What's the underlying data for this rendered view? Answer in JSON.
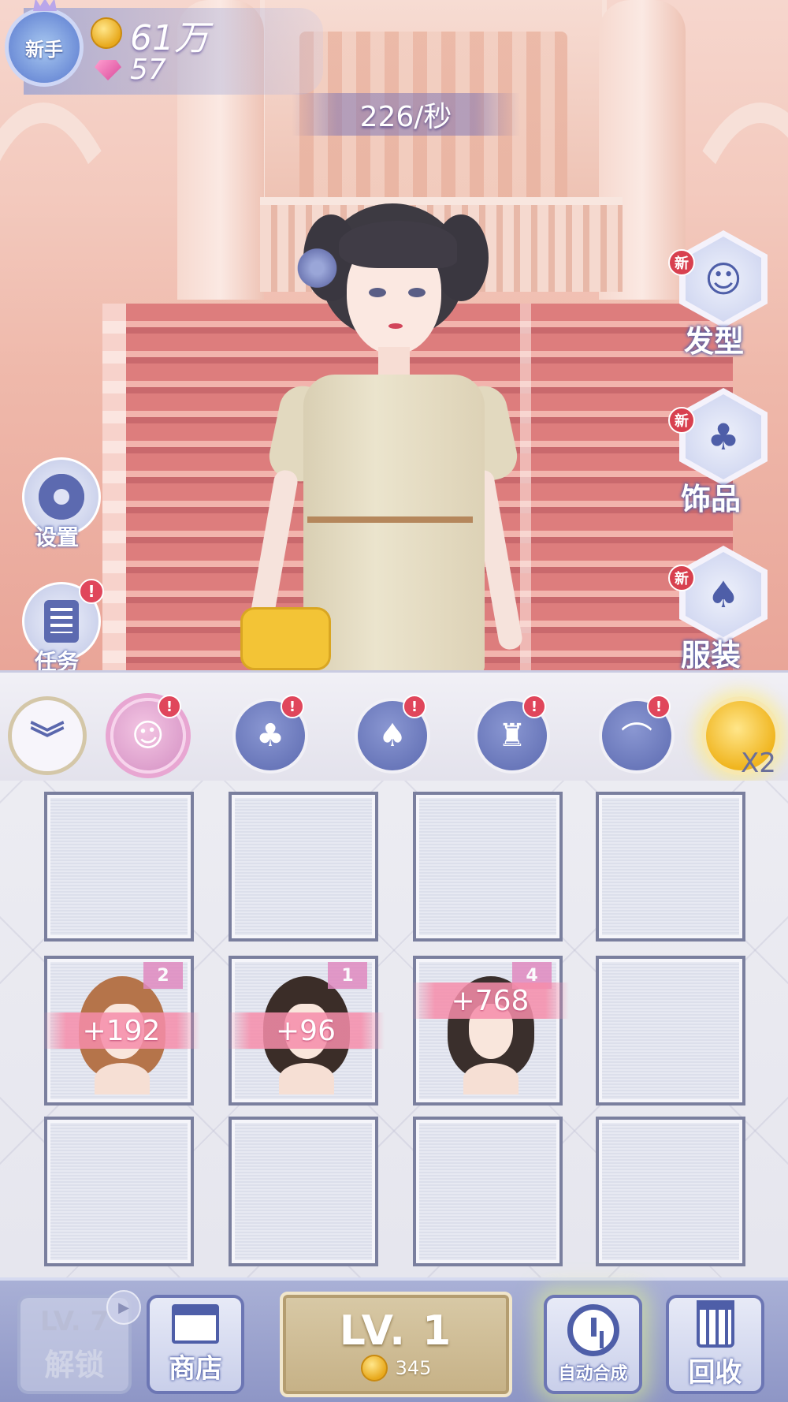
{
  "hud": {
    "avatar_label": "新手",
    "gold": "61万",
    "gems": "57",
    "rate": "226/秒"
  },
  "left_menu": [
    {
      "label": "设置",
      "icon": "gear-icon",
      "alert": ""
    },
    {
      "label": "任务",
      "icon": "task-list-icon",
      "alert": "!"
    }
  ],
  "right_menu": [
    {
      "label": "发型",
      "icon": "hairstyle-icon",
      "badge": "新"
    },
    {
      "label": "饰品",
      "icon": "accessory-icon",
      "badge": "新"
    },
    {
      "label": "服装",
      "icon": "dress-icon",
      "badge": "新"
    }
  ],
  "category_tabs": [
    {
      "icon": "hair-category-icon",
      "alert": "!",
      "active": true
    },
    {
      "icon": "accessory-category-icon",
      "alert": "!"
    },
    {
      "icon": "dress-category-icon",
      "alert": "!"
    },
    {
      "icon": "makeup-category-icon",
      "alert": "!"
    },
    {
      "icon": "shoes-category-icon",
      "alert": "!"
    }
  ],
  "double_bonus": {
    "label": "X2"
  },
  "grid": {
    "rows": 3,
    "cols": 4,
    "items": [
      {
        "row": 1,
        "col": 0,
        "level": "2",
        "income": "+192",
        "hair_color": "#b5744a"
      },
      {
        "row": 1,
        "col": 1,
        "level": "1",
        "income": "+96",
        "hair_color": "#3b2d28"
      },
      {
        "row": 1,
        "col": 2,
        "level": "4",
        "income": "+768",
        "hair_color": "#3a2f2c"
      }
    ]
  },
  "bottom_bar": {
    "locked": {
      "level": "LV. 7",
      "label": "解锁"
    },
    "shop": {
      "label": "商店"
    },
    "buy": {
      "level": "LV. 1",
      "cost": "345"
    },
    "auto_merge": {
      "label": "自动合成"
    },
    "recycle": {
      "label": "回收"
    }
  },
  "colors": {
    "accent": "#5c6ab0",
    "alert": "#e0465b",
    "income_ribbon": "#f68daa",
    "gold": "#e8a91c"
  }
}
